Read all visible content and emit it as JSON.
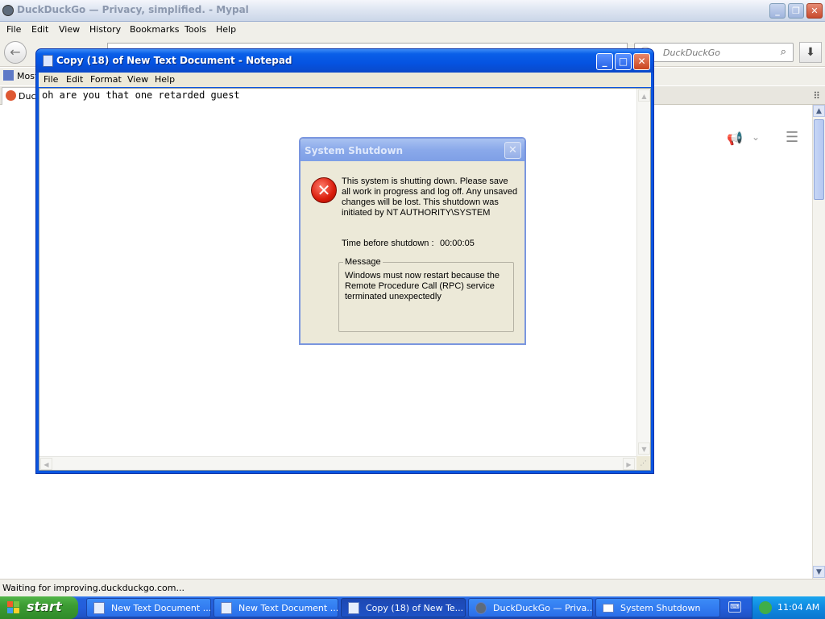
{
  "browser": {
    "title": "DuckDuckGo — Privacy, simplified. - Mypal",
    "menu": [
      "File",
      "Edit",
      "View",
      "History",
      "Bookmarks",
      "Tools",
      "Help"
    ],
    "search_placeholder": "DuckDuckGo",
    "bookmark_label": "Most",
    "tab_label": "Duck",
    "status": "Waiting for improving.duckduckgo.com..."
  },
  "notepad": {
    "title": "Copy (18) of New Text Document - Notepad",
    "menu": [
      "File",
      "Edit",
      "Format",
      "View",
      "Help"
    ],
    "content": "oh are you that one retarded guest"
  },
  "shutdown_dialog": {
    "title": "System Shutdown",
    "message": "This system is shutting down. Please save all work in progress and log off. Any unsaved changes will be lost. This shutdown was initiated by NT AUTHORITY\\SYSTEM",
    "time_label": "Time before shutdown :",
    "time_value": "00:00:05",
    "group_label": "Message",
    "group_text": "Windows must now restart because the Remote Procedure Call (RPC) service terminated unexpectedly"
  },
  "taskbar": {
    "start_label": "start",
    "tasks": [
      {
        "label": "New Text Document ..."
      },
      {
        "label": "New Text Document ..."
      },
      {
        "label": "Copy (18) of New Te..."
      },
      {
        "label": "DuckDuckGo — Priva..."
      },
      {
        "label": "System Shutdown"
      }
    ],
    "clock": "11:04 AM"
  },
  "colors": {
    "taskbar_blue": "#245edb",
    "start_green": "#3c9c33",
    "error_red": "#d91c0b",
    "xp_title_blue": "#0553e1"
  },
  "icons": [
    "firefox-icon",
    "back-arrow-icon",
    "search-icon",
    "download-icon",
    "duckduckgo-icon",
    "megaphone-icon",
    "menu-icon",
    "notepad-icon",
    "error-icon",
    "windows-flag-icon",
    "keyboard-icon",
    "network-icon"
  ]
}
